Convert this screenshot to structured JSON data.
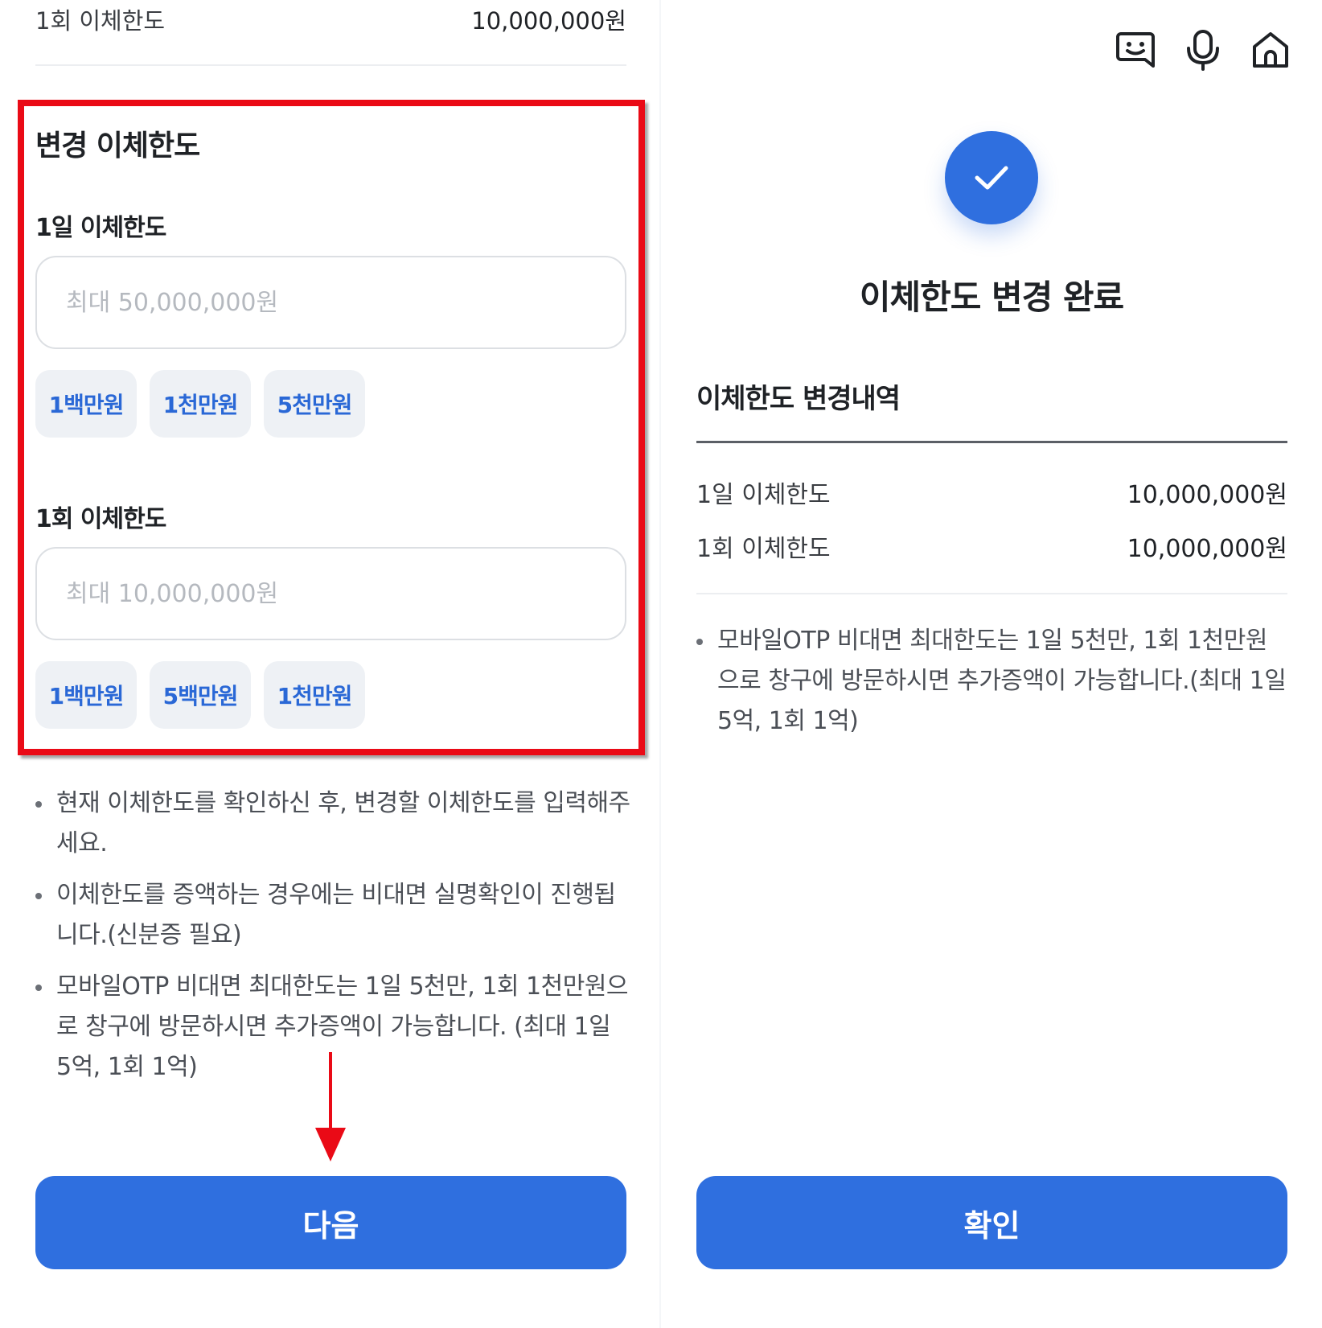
{
  "left": {
    "top_row": {
      "label": "1회 이체한도",
      "value": "10,000,000원"
    },
    "section_title": "변경 이체한도",
    "daily": {
      "label": "1일 이체한도",
      "placeholder": "최대 50,000,000원",
      "value": "",
      "chips": [
        "1백만원",
        "1천만원",
        "5천만원"
      ]
    },
    "per_transfer": {
      "label": "1회 이체한도",
      "placeholder": "최대 10,000,000원",
      "value": "",
      "chips": [
        "1백만원",
        "5백만원",
        "1천만원"
      ]
    },
    "notes": [
      "현재 이체한도를 확인하신 후, 변경할 이체한도를 입력해주세요.",
      "이체한도를 증액하는 경우에는 비대면 실명확인이 진행됩니다.(신분증 필요)",
      "모바일OTP 비대면 최대한도는 1일 5천만, 1회 1천만원으로 창구에 방문하시면 추가증액이 가능합니다. (최대 1일 5억, 1회 1억)"
    ],
    "next_button": "다음",
    "highlight_color": "#ea0a16"
  },
  "right": {
    "icons": [
      "chatbot-icon",
      "microphone-icon",
      "home-icon"
    ],
    "title": "이체한도 변경 완료",
    "history_title": "이체한도 변경내역",
    "rows": [
      {
        "label": "1일 이체한도",
        "value": "10,000,000원"
      },
      {
        "label": "1회 이체한도",
        "value": "10,000,000원"
      }
    ],
    "note": "모바일OTP 비대면 최대한도는 1일 5천만, 1회 1천만원으로 창구에 방문하시면 추가증액이 가능합니다.(최대 1일 5억, 1회 1억)",
    "confirm_button": "확인"
  },
  "colors": {
    "primary": "#2f6fdf",
    "chip_text": "#2a68d6",
    "chip_bg": "#eef1f5",
    "annotation_red": "#ea0a16"
  }
}
